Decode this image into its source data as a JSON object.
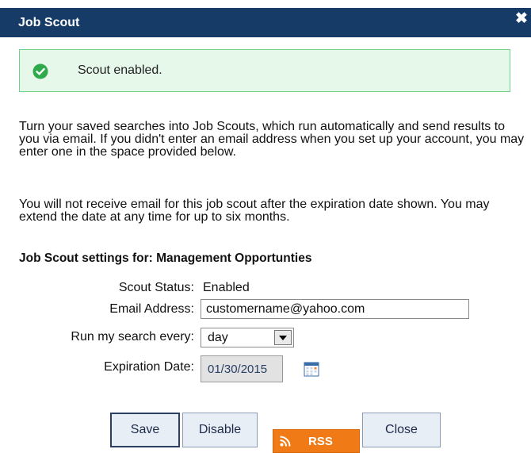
{
  "dialog": {
    "title": "Job Scout",
    "close_icon": "close-icon"
  },
  "alert": {
    "icon": "check-circle-icon",
    "message": "Scout enabled.",
    "colors": {
      "background": "#e6f8ea",
      "border": "#6ed28a",
      "icon": "#2faa4a"
    }
  },
  "intro": {
    "paragraph1": "Turn your saved searches into Job Scouts, which run automatically and send results to you via email. If you didn't enter an email address when you set up your account, you may enter one in the space provided below.",
    "paragraph2": "You will not receive email for this job scout after the expiration date shown. You may extend the date at any time for up to six months."
  },
  "settings": {
    "title": "Job Scout settings for: Management Opportunties",
    "status_label": "Scout Status:",
    "status_value": "Enabled",
    "email_label": "Email Address:",
    "email_value": "customername@yahoo.com",
    "frequency_label": "Run my search every:",
    "frequency_value": "day",
    "expiration_label": "Expiration Date:",
    "expiration_value": "01/30/2015",
    "calendar_icon": "calendar-icon"
  },
  "buttons": {
    "save": "Save",
    "disable": "Disable",
    "rss": "RSS",
    "close": "Close"
  },
  "colors": {
    "titlebar": "#163b66",
    "rss": "#f07a16"
  }
}
